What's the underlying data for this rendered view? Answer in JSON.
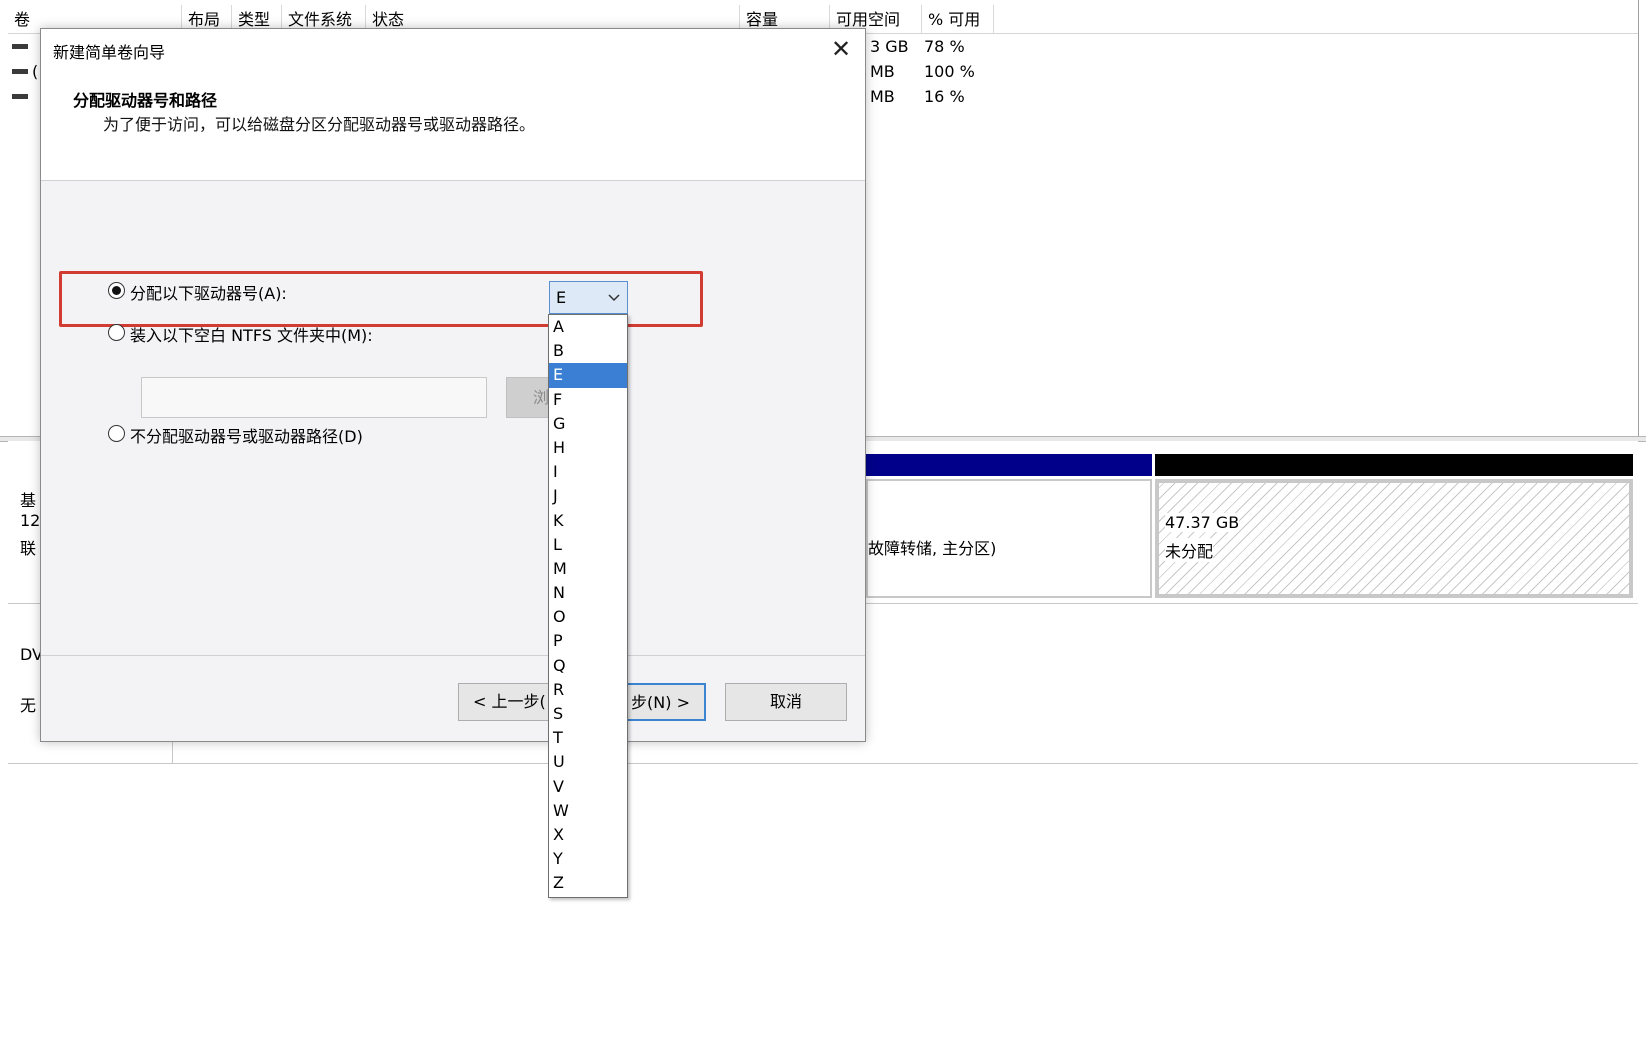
{
  "table": {
    "columns": [
      "卷",
      "布局",
      "类型",
      "文件系统",
      "状态",
      "容量",
      "可用空间",
      "% 可用"
    ],
    "rows": [
      {
        "prefix": "",
        "free": "3 GB",
        "pct": "78 %"
      },
      {
        "prefix": "(",
        "free": "MB",
        "pct": "100 %"
      },
      {
        "prefix": "",
        "free": "MB",
        "pct": "16 %"
      }
    ]
  },
  "disk0": {
    "name_partial": "基",
    "size_partial": "12",
    "status_partial": "联",
    "partition_status_partial": "故障转储, 主分区)",
    "unallocated_size": "47.37 GB",
    "unallocated_label": "未分配"
  },
  "cdrom": {
    "name_partial": "DV",
    "status_partial": "无"
  },
  "dialog": {
    "title": "新建简单卷向导",
    "close_label": "✕",
    "heading": "分配驱动器号和路径",
    "description": "为了便于访问，可以给磁盘分区分配驱动器号或驱动器路径。",
    "option_assign": "分配以下驱动器号(A):",
    "option_mount": "装入以下空白 NTFS 文件夹中(M):",
    "option_none": "不分配驱动器号或驱动器路径(D)",
    "browse_partial": "浏",
    "folder_path_value": "",
    "selected_letter": "E",
    "back_label": "< 上一步(",
    "next_label": "步(N) >",
    "cancel_label": "取消"
  },
  "dropdown": {
    "options": [
      "A",
      "B",
      "E",
      "F",
      "G",
      "H",
      "I",
      "J",
      "K",
      "L",
      "M",
      "N",
      "O",
      "P",
      "Q",
      "R",
      "S",
      "T",
      "U",
      "V",
      "W",
      "X",
      "Y",
      "Z"
    ],
    "selected": "E"
  },
  "colors": {
    "highlight": "#d23b32",
    "selection": "#3a7fd4",
    "primary_partition_bar": "#00008b",
    "unallocated_bar": "#000000"
  }
}
